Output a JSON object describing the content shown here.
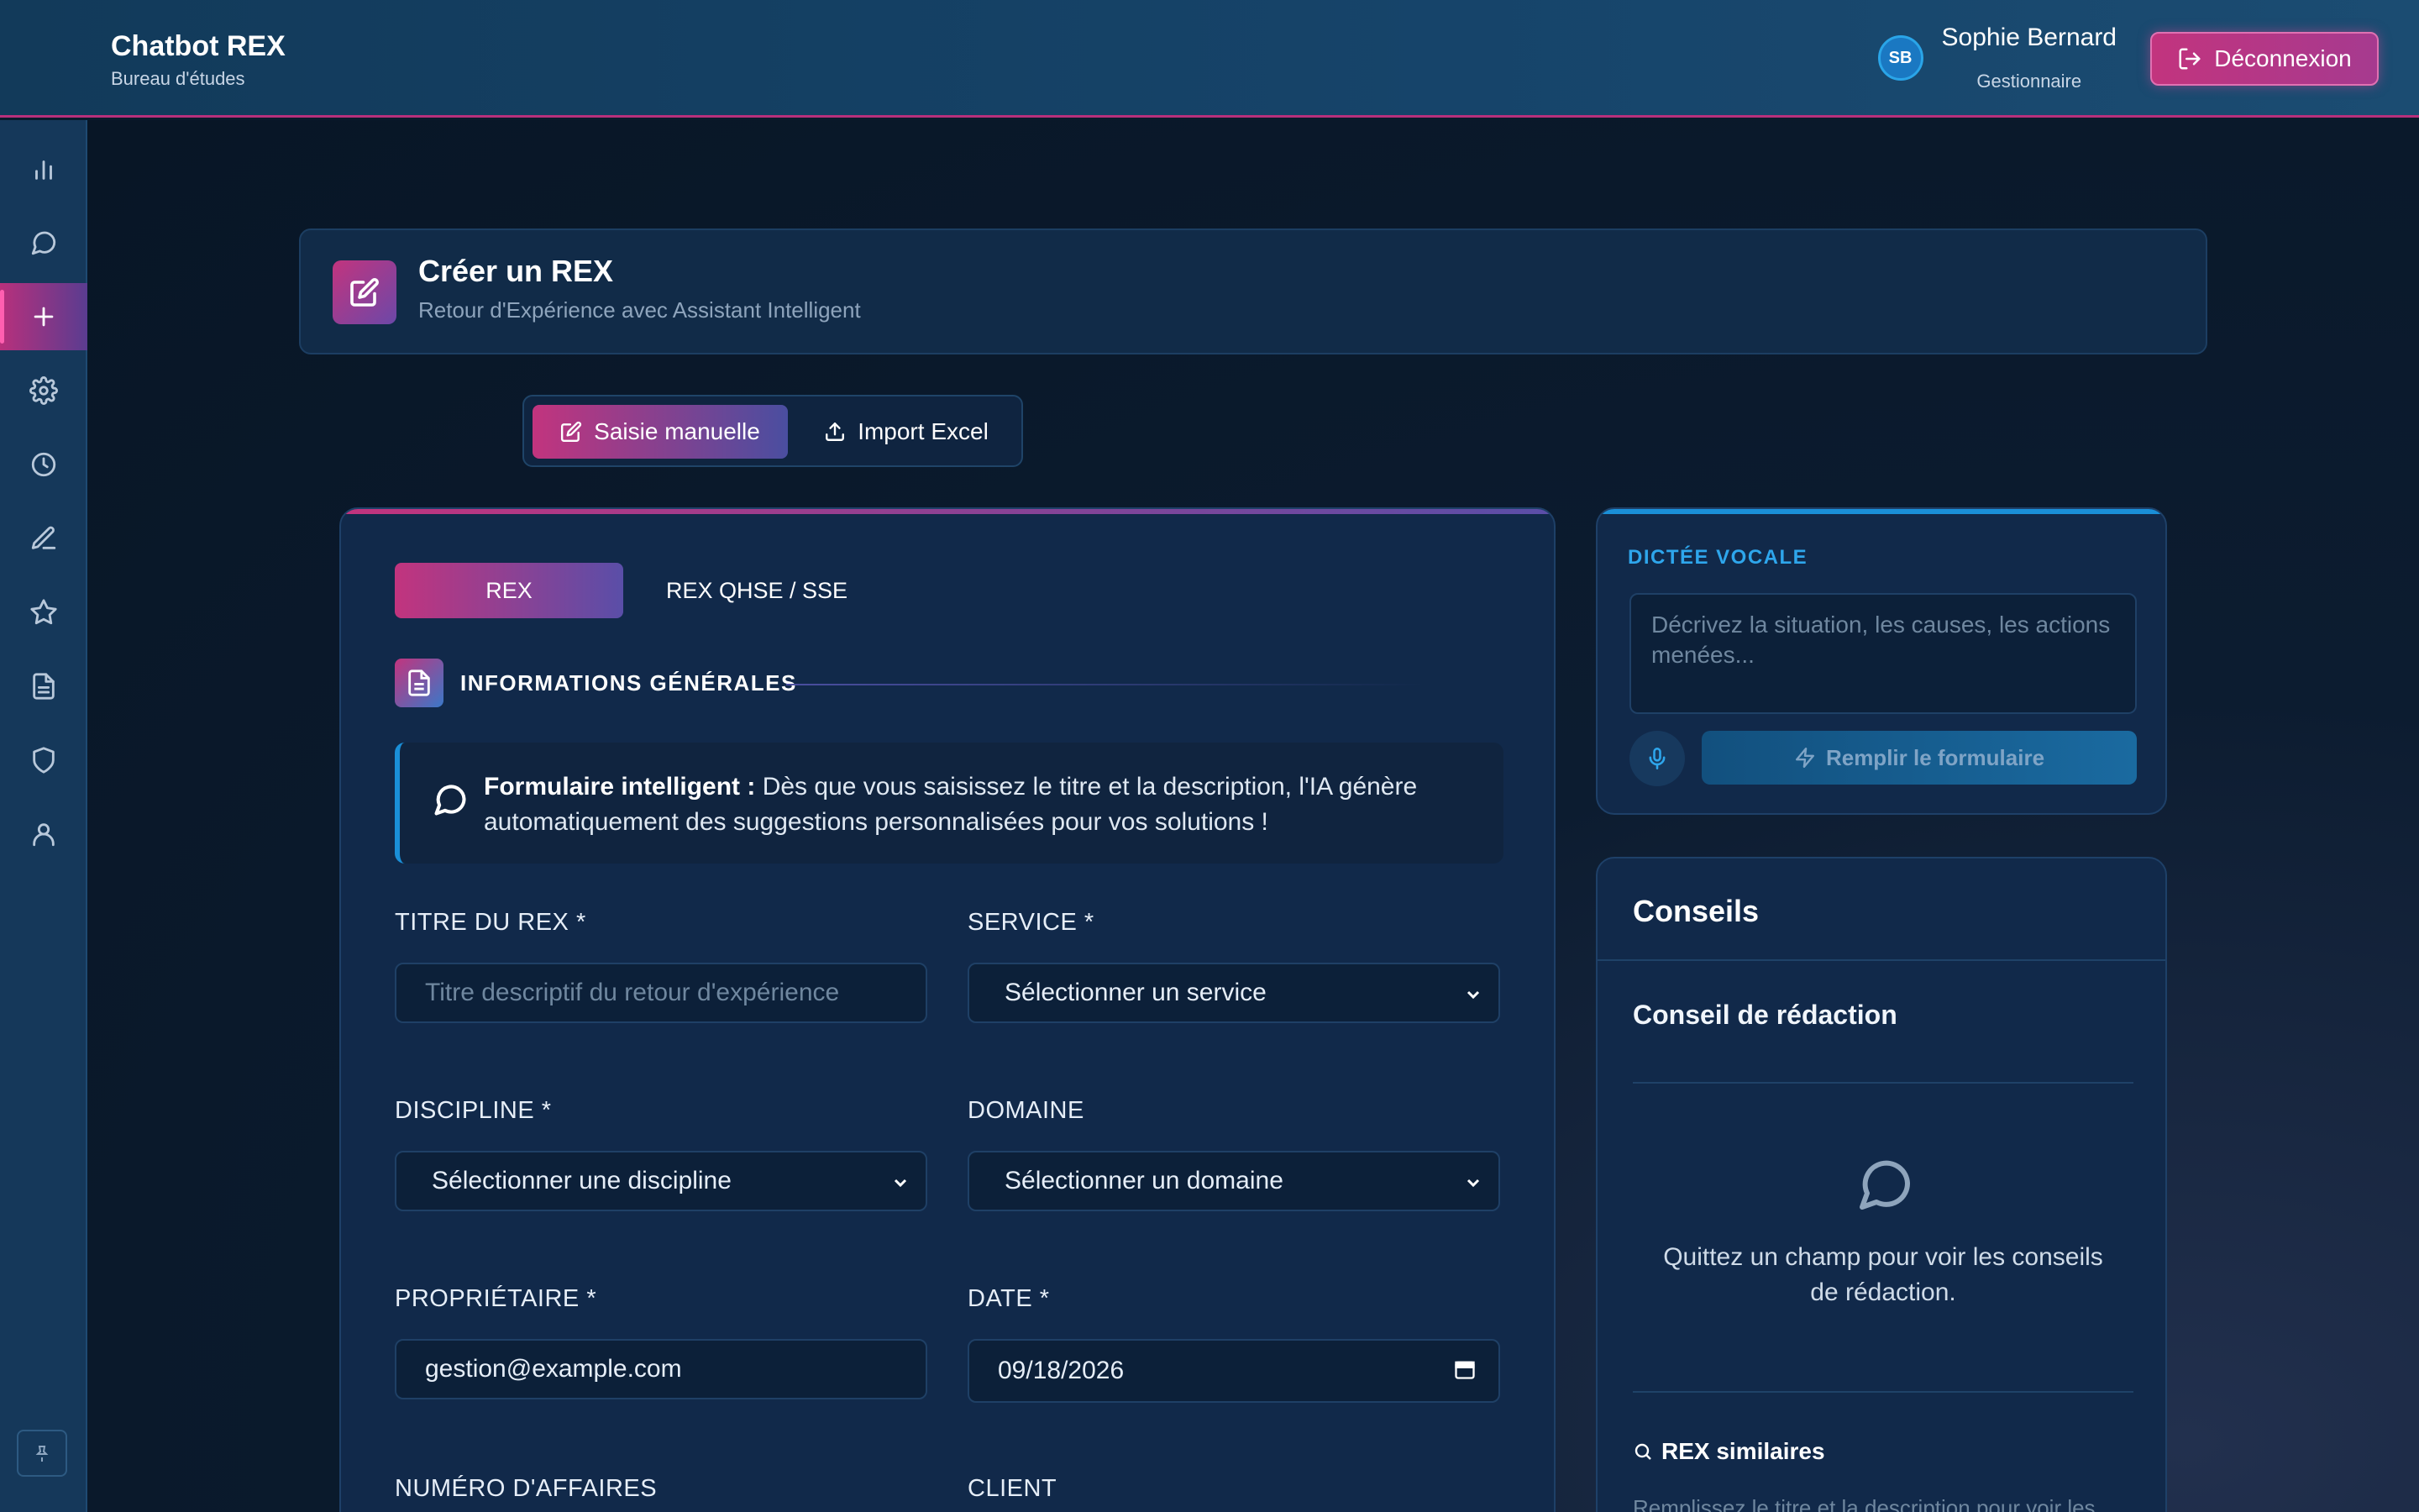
{
  "app": {
    "title": "Chatbot REX",
    "subtitle": "Bureau d'études"
  },
  "user": {
    "initials": "SB",
    "name": "Sophie Bernard",
    "role": "Gestionnaire",
    "logout_label": "Déconnexion"
  },
  "sidebar": {
    "items": [
      {
        "name": "chart-icon"
      },
      {
        "name": "chat-icon"
      },
      {
        "name": "plus-icon",
        "active": true
      },
      {
        "name": "gear-icon"
      },
      {
        "name": "clock-icon"
      },
      {
        "name": "pencil-icon"
      },
      {
        "name": "star-icon"
      },
      {
        "name": "document-icon"
      },
      {
        "name": "shield-icon"
      },
      {
        "name": "user-icon"
      }
    ],
    "pin_icon": "pin-icon"
  },
  "page": {
    "title": "Créer un REX",
    "subtitle": "Retour d'Expérience avec Assistant Intelligent"
  },
  "mode": {
    "manual_label": "Saisie manuelle",
    "import_label": "Import Excel",
    "selected": "manual"
  },
  "form": {
    "tabs": [
      "REX",
      "REX QHSE / SSE"
    ],
    "active_tab": "REX",
    "section_title": "INFORMATIONS GÉNÉRALES",
    "info_bold": "Formulaire intelligent :",
    "info_text": " Dès que vous saisissez le titre et la description, l'IA génère automatiquement des suggestions personnalisées pour vos solutions !",
    "fields": {
      "titre": {
        "label": "TITRE DU REX *",
        "placeholder": "Titre descriptif du retour d'expérience",
        "value": ""
      },
      "service": {
        "label": "SERVICE *",
        "value": "Sélectionner un service"
      },
      "discipline": {
        "label": "DISCIPLINE *",
        "value": "Sélectionner une discipline"
      },
      "domaine": {
        "label": "DOMAINE",
        "value": "Sélectionner un domaine"
      },
      "proprietaire": {
        "label": "PROPRIÉTAIRE *",
        "value": "gestion@example.com"
      },
      "date": {
        "label": "DATE *",
        "value": "09/18/2026"
      },
      "numero": {
        "label": "NUMÉRO D'AFFAIRES"
      },
      "client": {
        "label": "CLIENT"
      }
    }
  },
  "voice": {
    "title": "DICTÉE VOCALE",
    "placeholder": "Décrivez la situation, les causes, les actions menées...",
    "fill_label": "Remplir le formulaire"
  },
  "tips": {
    "title": "Conseils",
    "subtitle": "Conseil de rédaction",
    "empty_text": "Quittez un champ pour voir les conseils de rédaction.",
    "similar_title": "REX similaires",
    "similar_desc": "Remplissez le titre et la description pour voir les"
  },
  "colors": {
    "accent": "#c2347e",
    "accent2": "#5a4ea8",
    "info": "#1a8fd8",
    "background": "#0a1a2c"
  }
}
